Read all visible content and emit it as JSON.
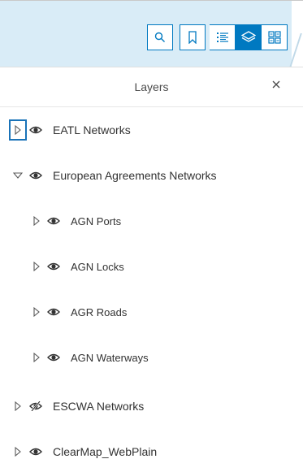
{
  "toolbar": {
    "search_icon": "search-icon",
    "bookmarks_icon": "bookmark-icon",
    "legend_icon": "legend-list-icon",
    "layers_icon": "layers-icon",
    "basemap_icon": "basemap-gallery-icon",
    "accent_color": "#0079c1"
  },
  "panel": {
    "title": "Layers",
    "close_icon": "close-icon"
  },
  "layers": [
    {
      "label": "EATL Networks",
      "expanded": false,
      "visible": true,
      "level": 0
    },
    {
      "label": "European Agreements Networks",
      "expanded": true,
      "visible": true,
      "level": 0
    },
    {
      "label": "AGN Ports",
      "expanded": false,
      "visible": true,
      "level": 1
    },
    {
      "label": "AGN Locks",
      "expanded": false,
      "visible": true,
      "level": 1
    },
    {
      "label": "AGR Roads",
      "expanded": false,
      "visible": true,
      "level": 1
    },
    {
      "label": "AGN Waterways",
      "expanded": false,
      "visible": true,
      "level": 1
    },
    {
      "label": "ESCWA Networks",
      "expanded": false,
      "visible": false,
      "level": 0
    },
    {
      "label": "ClearMap_WebPlain",
      "expanded": false,
      "visible": true,
      "level": 0
    }
  ]
}
